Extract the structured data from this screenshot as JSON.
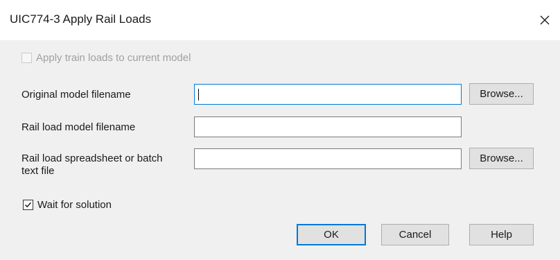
{
  "window": {
    "title": "UIC774-3 Apply Rail Loads",
    "close_glyph": "×"
  },
  "apply_train_loads": {
    "label": "Apply train loads to current model",
    "checked": false,
    "enabled": false
  },
  "fields": {
    "original_model": {
      "label": "Original model filename",
      "value": "",
      "browse_label": "Browse..."
    },
    "rail_load_model": {
      "label": "Rail load model filename",
      "value": ""
    },
    "rail_load_spreadsheet": {
      "label_line1": "Rail load spreadsheet or batch",
      "label_line2": "text file",
      "value": "",
      "browse_label": "Browse..."
    }
  },
  "wait_for_solution": {
    "label": "Wait for solution",
    "checked": true
  },
  "buttons": {
    "ok": "OK",
    "cancel": "Cancel",
    "help": "Help"
  },
  "colors": {
    "accent": "#0078d7",
    "dialog_bg": "#f0f0f0",
    "disabled_text": "#a0a0a0"
  }
}
